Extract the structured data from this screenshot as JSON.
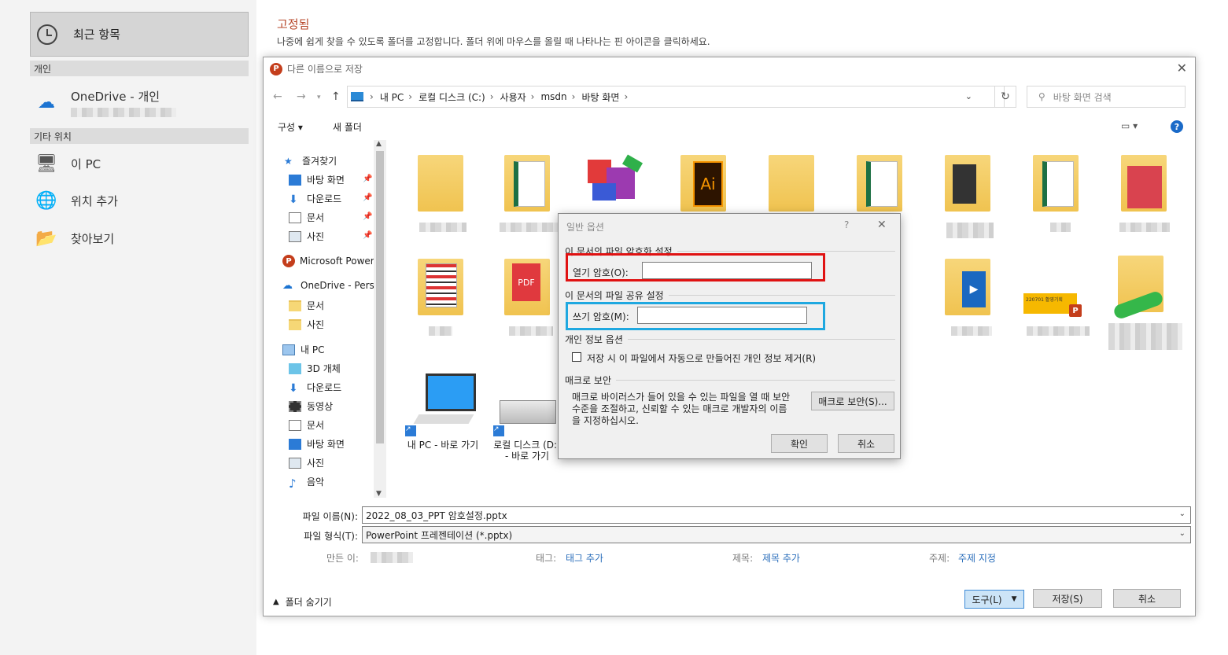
{
  "left_nav": {
    "recent": "최근 항목",
    "personal_header": "개인",
    "onedrive": "OneDrive - 개인",
    "other_header": "기타 위치",
    "this_pc": "이 PC",
    "add_place": "위치 추가",
    "browse": "찾아보기"
  },
  "pinned": {
    "title": "고정됨",
    "desc": "나중에 쉽게 찾을 수 있도록 폴더를 고정합니다. 폴더 위에 마우스를 올릴 때 나타나는 핀 아이콘을 클릭하세요."
  },
  "save_dialog": {
    "title": "다른 이름으로 저장",
    "breadcrumb": [
      "내 PC",
      "로컬 디스크 (C:)",
      "사용자",
      "msdn",
      "바탕 화면"
    ],
    "search_placeholder": "바탕 화면 검색",
    "organize": "구성 ▾",
    "new_folder": "새 폴더",
    "tree": [
      {
        "label": "즐겨찾기",
        "icon": "star-icon"
      },
      {
        "label": "바탕 화면",
        "icon": "desktop-icon",
        "pinned": true
      },
      {
        "label": "다운로드",
        "icon": "download-icon",
        "pinned": true
      },
      {
        "label": "문서",
        "icon": "document-icon",
        "pinned": true
      },
      {
        "label": "사진",
        "icon": "picture-icon",
        "pinned": true
      },
      {
        "label": "Microsoft PowerP",
        "icon": "powerpoint-icon"
      },
      {
        "label": "OneDrive - Persor",
        "icon": "onedrive-icon"
      },
      {
        "label": "문서",
        "icon": "folder-icon"
      },
      {
        "label": "사진",
        "icon": "folder-icon"
      },
      {
        "label": "내 PC",
        "icon": "pc-icon"
      },
      {
        "label": "3D 개체",
        "icon": "cube-icon"
      },
      {
        "label": "다운로드",
        "icon": "download-icon"
      },
      {
        "label": "동영상",
        "icon": "video-icon"
      },
      {
        "label": "문서",
        "icon": "document-icon"
      },
      {
        "label": "바탕 화면",
        "icon": "desktop-icon"
      },
      {
        "label": "사진",
        "icon": "picture-icon"
      },
      {
        "label": "음악",
        "icon": "music-icon"
      }
    ],
    "shortcuts": {
      "my_pc": "내 PC - 바로 가기",
      "local_disk": "로컬 디스크 (D:) - 바로 가기"
    },
    "file_name_label": "파일 이름(N):",
    "file_name": "2022_08_03_PPT 암호설정.pptx",
    "file_type_label": "파일 형식(T):",
    "file_type": "PowerPoint 프레젠테이션 (*.pptx)",
    "author_label": "만든 이:",
    "tags_label": "태그:",
    "tags_value": "태그 추가",
    "subject_label": "제목:",
    "subject_value": "제목 추가",
    "topic_label": "주제:",
    "topic_value": "주제 지정",
    "hide_folders": "폴더 숨기기",
    "tools": "도구(L)",
    "save": "저장(S)",
    "cancel": "취소"
  },
  "general_options": {
    "title": "일반 옵션",
    "help": "?",
    "encrypt_group": "이 문서의 파일 암호화 설정",
    "open_password_label": "열기 암호(O):",
    "share_group": "이 문서의 파일 공유 설정",
    "modify_password_label": "쓰기 암호(M):",
    "privacy_group": "개인 정보 옵션",
    "privacy_checkbox": "저장 시 이 파일에서 자동으로 만들어진 개인 정보 제거(R)",
    "macro_group": "매크로 보안",
    "macro_desc": "매크로 바이러스가 들어 있을 수 있는 파일을 열 때 보안 수준을 조절하고, 신뢰할 수 있는 매크로 개발자의 이름을 지정하십시오.",
    "macro_button": "매크로 보안(S)...",
    "ok": "확인",
    "cancel": "취소"
  },
  "colors": {
    "accent_red": "#e01212",
    "accent_blue": "#1fa8e0",
    "powerpoint": "#c43e1c",
    "link": "#2a6ebb"
  }
}
